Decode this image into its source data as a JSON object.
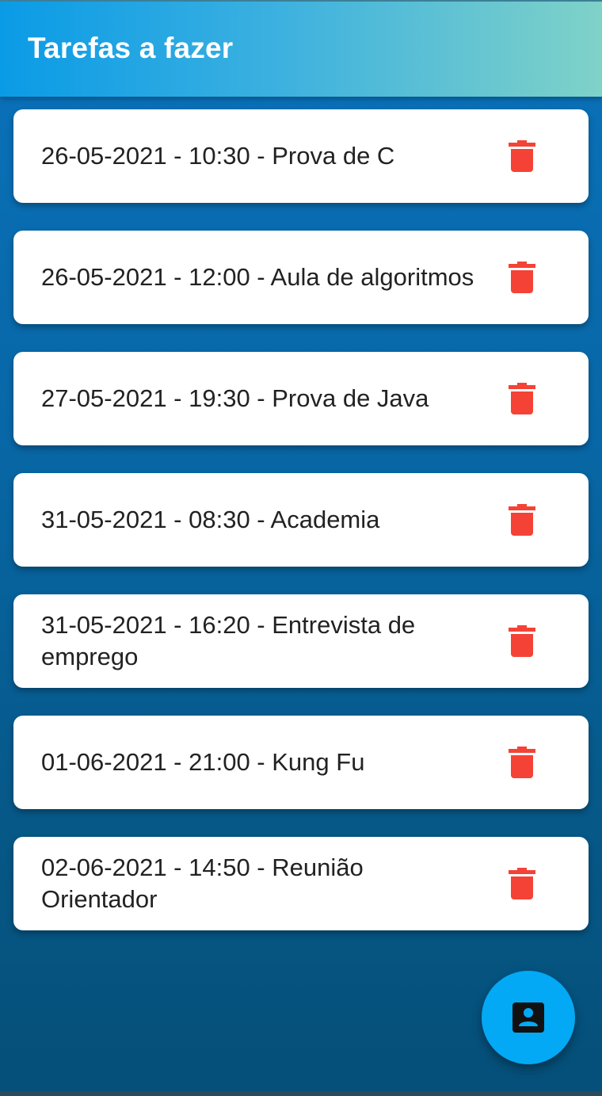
{
  "app_bar": {
    "title": "Tarefas a fazer"
  },
  "tasks": [
    {
      "label": "26-05-2021 - 10:30 - Prova de C",
      "action_icon": "delete-icon"
    },
    {
      "label": "26-05-2021 - 12:00 - Aula de algoritmos",
      "action_icon": "delete-icon"
    },
    {
      "label": "27-05-2021 - 19:30 - Prova de Java",
      "action_icon": "delete-icon"
    },
    {
      "label": "31-05-2021 - 08:30 - Academia",
      "action_icon": "delete-icon"
    },
    {
      "label": "31-05-2021 - 16:20 - Entrevista de emprego",
      "action_icon": "delete-icon"
    },
    {
      "label": "01-06-2021 - 21:00 - Kung Fu",
      "action_icon": "delete-icon"
    },
    {
      "label": "02-06-2021 - 14:50 - Reunião Orientador",
      "action_icon": "delete-icon"
    }
  ],
  "fab": {
    "icon": "contact-icon"
  },
  "colors": {
    "delete_icon": "#f44336",
    "fab_background": "#03a9f4",
    "card_text": "#222222"
  }
}
